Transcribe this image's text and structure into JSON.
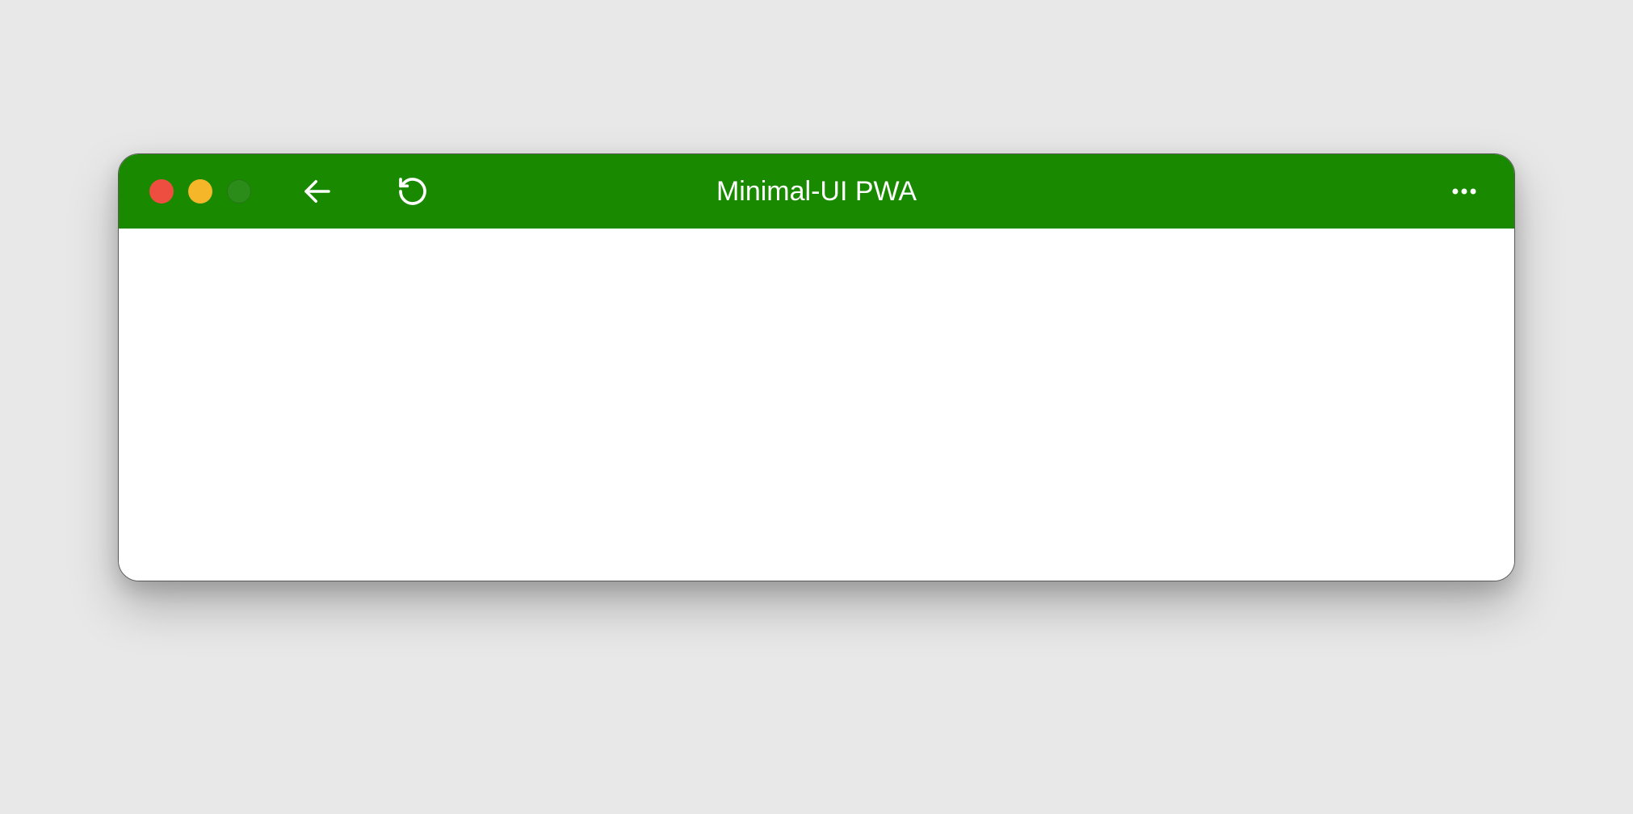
{
  "window": {
    "title": "Minimal-UI PWA",
    "titlebar_color": "#198a00",
    "content_color": "#ffffff"
  },
  "traffic_lights": {
    "close_color": "#ee4e3f",
    "minimize_color": "#f6b62a",
    "maximize_color": "#2b8c1a"
  },
  "icons": {
    "back": "arrow-left-icon",
    "reload": "reload-icon",
    "more": "more-horizontal-icon"
  }
}
